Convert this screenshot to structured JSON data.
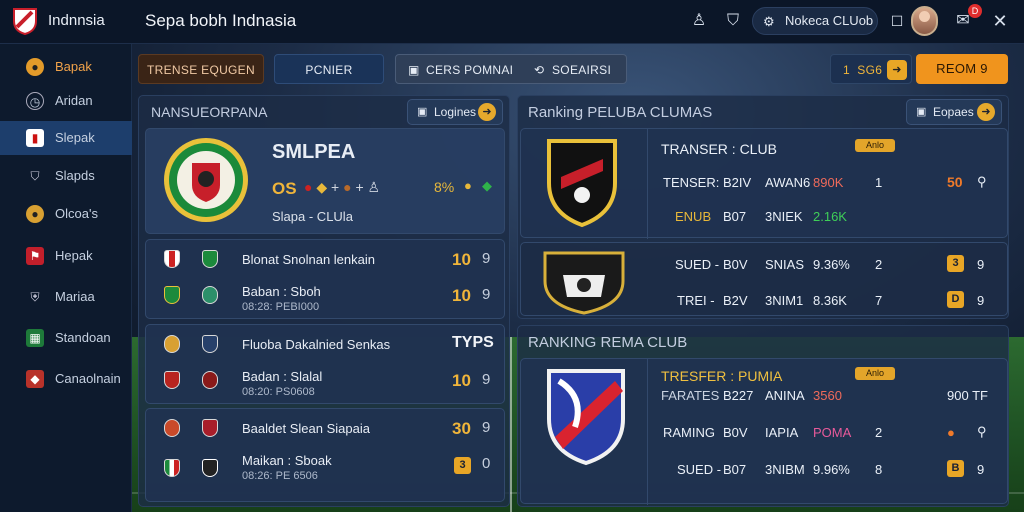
{
  "topbar": {
    "app_title": "Indnnsia",
    "page_title": "Sepa bobh Indnasia",
    "club_pill": "Nokeca CLUob",
    "notif_count": "D"
  },
  "sidebar": {
    "items": [
      {
        "label": "Bapak",
        "icon": "user-icon"
      },
      {
        "label": "Aridan",
        "icon": "clock-icon"
      },
      {
        "label": "Slepak",
        "icon": "club-crest-icon"
      },
      {
        "label": "Slapds",
        "icon": "shield-icon"
      },
      {
        "label": "Olcoa's",
        "icon": "team-icon"
      },
      {
        "label": "Hepak",
        "icon": "flag-icon"
      },
      {
        "label": "Mariaa",
        "icon": "shield-icon"
      },
      {
        "label": "Standoan",
        "icon": "table-icon"
      },
      {
        "label": "Canaolnain",
        "icon": "crest-icon"
      }
    ]
  },
  "tabs": {
    "t1": "TRENSE EQUGEN",
    "t2": "PCNIER",
    "t3": "CERS POMNAI",
    "t4": "SOEAIRSI"
  },
  "header_right": {
    "counter_num": "1",
    "counter_label": "SG6",
    "orange_btn": "REOM 9"
  },
  "left_panel": {
    "title": "NANSUEORPANA",
    "btn": "Logines",
    "featured": {
      "name": "SMLPEA",
      "score": "OS",
      "percent": "8%",
      "sub": "Slapa - CLUla"
    },
    "rows": [
      {
        "title": "Blonat Snolnan lenkain",
        "sub": "Baban : Sboh",
        "sub2": "08:28: PEBI000",
        "score_a": "10",
        "score_b": "9",
        "score_c": "10",
        "score_d": "9"
      },
      {
        "title": "Fluoba Dakalnied Senkas",
        "extra": "TYPS",
        "sub": "Badan : Slalal",
        "sub2": "08:20: PS0608",
        "score_c": "10",
        "score_d": "9"
      },
      {
        "title": "Baaldet Slean Siapaia",
        "sub": "Maikan : Sboak",
        "sub2": "08:26: PE 6506",
        "score_a": "30",
        "score_b": "9",
        "badge_c": "3",
        "score_d": "0"
      }
    ]
  },
  "right_top": {
    "title": "Ranking PELUBA CLUMAS",
    "btn": "Eopaes",
    "club": "TRANSER : CLUB",
    "tag": "Anlo",
    "r1": {
      "a": "TENSER:",
      "b": "B2IV",
      "c": "AWAN6",
      "d": "890K",
      "e": "1",
      "f": "50"
    },
    "r2": {
      "a": "ENUB",
      "b": "B07",
      "c": "3NIEK",
      "d": "2.16K"
    },
    "r3": {
      "a": "SUED -",
      "b": "B0V",
      "c": "SNIAS",
      "d": "9.36%",
      "e": "2",
      "f": "3",
      "g": "9"
    },
    "r4": {
      "a": "TREI -",
      "b": "B2V",
      "c": "3NIM1",
      "d": "8.36K",
      "e": "7",
      "f": "D",
      "g": "9"
    }
  },
  "right_bottom": {
    "title": "RANKING REMA CLUB",
    "club": "TRESFER : PUMIA",
    "tag": "Anlo",
    "r1": {
      "a": "FARATES",
      "b": "B227",
      "c": "ANINA",
      "d": "3560",
      "e": "900 TF"
    },
    "r2": {
      "a": "RAMING",
      "b": "B0V",
      "c": "IAPIA",
      "d": "POMA",
      "e": "2"
    },
    "r3": {
      "a": "SUED -",
      "b": "B07",
      "c": "3NIBM",
      "d": "9.96%",
      "e": "8",
      "f": "B",
      "g": "9"
    }
  },
  "colors": {
    "accent": "#e8a626",
    "orange": "#f0941d",
    "bg": "#0b1628",
    "active": "#1d3e6c"
  }
}
